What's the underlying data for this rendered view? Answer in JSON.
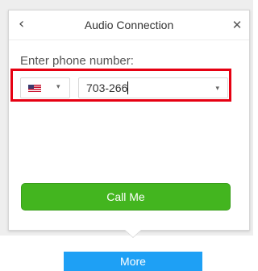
{
  "popup": {
    "title": "Audio Connection",
    "back_icon": "‹",
    "close_icon": "✕"
  },
  "form": {
    "prompt": "Enter phone number:",
    "country_icon": "us-flag-icon",
    "country_caret": "▾",
    "phone_value": "703-266",
    "phone_caret": "▾"
  },
  "actions": {
    "call_label": "Call Me",
    "more_label": "More"
  },
  "colors": {
    "call_button": "#43b51f",
    "more_button": "#1ea0f5",
    "highlight": "#e60012"
  }
}
